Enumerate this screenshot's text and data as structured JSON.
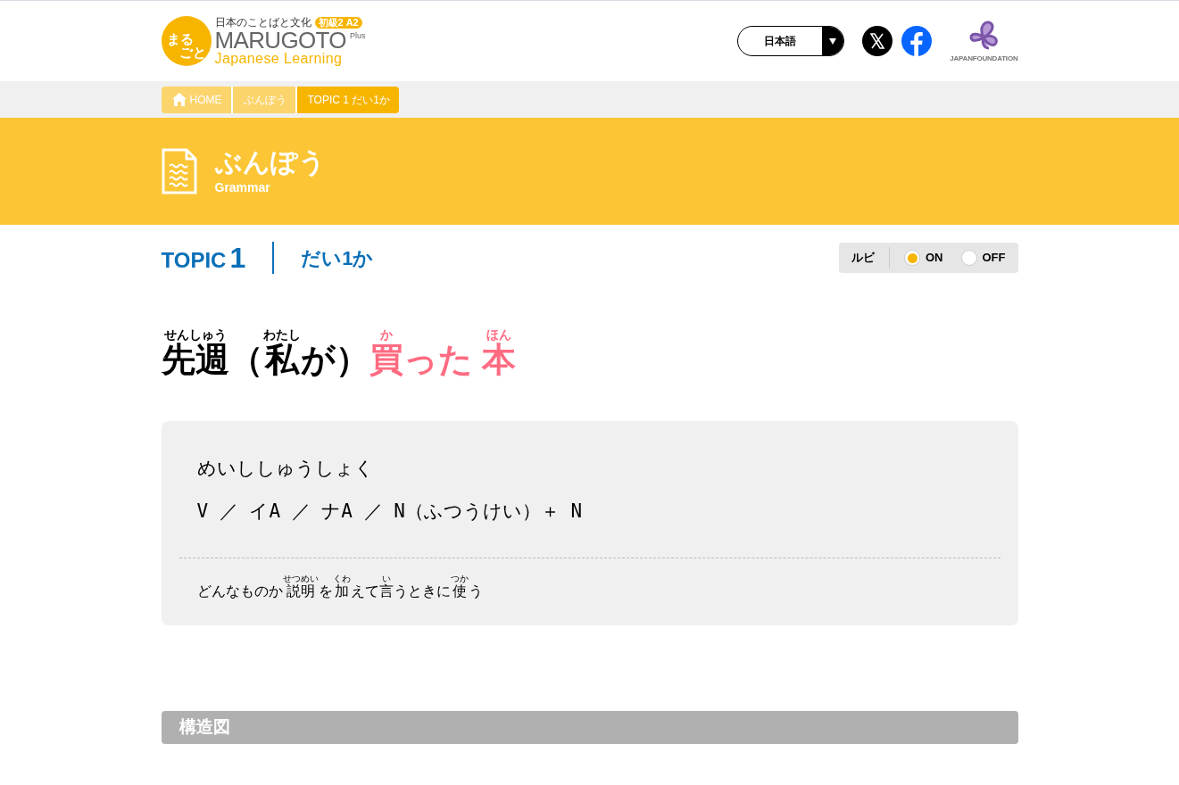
{
  "logo": {
    "mark_top": "まる",
    "mark_bottom": "ごと",
    "tagline": "日本のことばと文化",
    "level_badge": "初級2 A2",
    "name": "MARUGOTO",
    "plus": "Plus",
    "subtitle": "Japanese Learning"
  },
  "language_select": {
    "value": "日本語"
  },
  "foundation": {
    "name": "JAPANFOUNDATION"
  },
  "breadcrumb": [
    {
      "label": "HOME",
      "kind": "home",
      "selected": false
    },
    {
      "label": "ぶんぽう",
      "kind": "link",
      "selected": false
    },
    {
      "label": "TOPIC 1 だい1か",
      "kind": "link",
      "selected": true
    }
  ],
  "banner": {
    "title": "ぶんぽう",
    "subtitle": "Grammar"
  },
  "topic": {
    "label": "TOPIC",
    "number": "1",
    "lesson": "だい1か"
  },
  "ruby_toggle": {
    "label": "ルビ",
    "options": [
      {
        "label": "ON",
        "selected": true
      },
      {
        "label": "OFF",
        "selected": false
      }
    ]
  },
  "sentence": [
    {
      "base": "先週",
      "ruby": "せんしゅう",
      "highlight": false
    },
    {
      "base": "（",
      "highlight": false
    },
    {
      "base": "私",
      "ruby": "わたし",
      "highlight": false
    },
    {
      "base": "が）",
      "highlight": false
    },
    {
      "base": "買",
      "ruby": "か",
      "highlight": true
    },
    {
      "base": "った ",
      "highlight": true
    },
    {
      "base": "本",
      "ruby": "ほん",
      "highlight": true
    }
  ],
  "card": {
    "name": "めいししゅうしょく",
    "pattern": "V ／ イA ／ ナA ／ N（ふつうけい）＋ N",
    "usage": [
      {
        "base": "どんなものか"
      },
      {
        "base": "説明",
        "ruby": "せつめい"
      },
      {
        "base": "を"
      },
      {
        "base": "加",
        "ruby": "くわ"
      },
      {
        "base": "えて"
      },
      {
        "base": "言",
        "ruby": "い"
      },
      {
        "base": "うときに"
      },
      {
        "base": "使",
        "ruby": "つか"
      },
      {
        "base": "う"
      }
    ]
  },
  "section": {
    "title": "構造図"
  }
}
